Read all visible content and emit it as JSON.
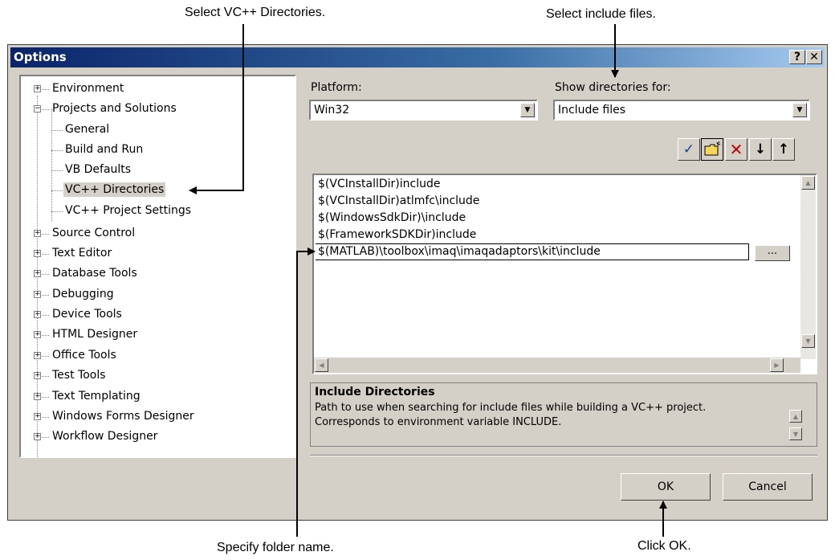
{
  "callouts": {
    "select_vc": "Select VC++ Directories.",
    "select_include": "Select include files.",
    "specify_folder": "Specify folder name.",
    "click_ok": "Click OK."
  },
  "dialog": {
    "title": "Options",
    "help_glyph": "?",
    "close_glyph": "✕"
  },
  "tree": {
    "items": [
      {
        "label": "Environment"
      },
      {
        "label": "Projects and Solutions"
      },
      {
        "label": "General"
      },
      {
        "label": "Build and Run"
      },
      {
        "label": "VB Defaults"
      },
      {
        "label": "VC++ Directories"
      },
      {
        "label": "VC++ Project Settings"
      },
      {
        "label": "Source Control"
      },
      {
        "label": "Text Editor"
      },
      {
        "label": "Database Tools"
      },
      {
        "label": "Debugging"
      },
      {
        "label": "Device Tools"
      },
      {
        "label": "HTML Designer"
      },
      {
        "label": "Office Tools"
      },
      {
        "label": "Test Tools"
      },
      {
        "label": "Text Templating"
      },
      {
        "label": "Windows Forms Designer"
      },
      {
        "label": "Workflow Designer"
      }
    ]
  },
  "platform": {
    "label": "Platform:",
    "value": "Win32"
  },
  "show_dirs": {
    "label": "Show directories for:",
    "value": "Include files"
  },
  "toolbar": {
    "check_icon": "check-icon",
    "new_folder_icon": "new-folder-icon",
    "delete_icon": "delete-icon",
    "move_down_icon": "arrow-down-icon",
    "move_up_icon": "arrow-up-icon"
  },
  "directories": {
    "lines": [
      "$(VCInstallDir)include",
      "$(VCInstallDir)atlmfc\\include",
      "$(WindowsSdkDir)\\include",
      "$(FrameworkSDKDir)include"
    ],
    "editing_value": "$(MATLAB)\\toolbox\\imaq\\imaqadaptors\\kit\\include",
    "browse_label": "..."
  },
  "description": {
    "heading": "Include Directories",
    "line1": "Path to use when searching for include files while building a VC++ project.",
    "line2": "Corresponds to environment variable INCLUDE."
  },
  "buttons": {
    "ok": "OK",
    "cancel": "Cancel"
  },
  "colors": {
    "title_start": "#0a246a",
    "title_end": "#a6caf0",
    "face": "#d4d0c8",
    "delete_red": "#c00000",
    "check_blue": "#1a3c9a"
  }
}
